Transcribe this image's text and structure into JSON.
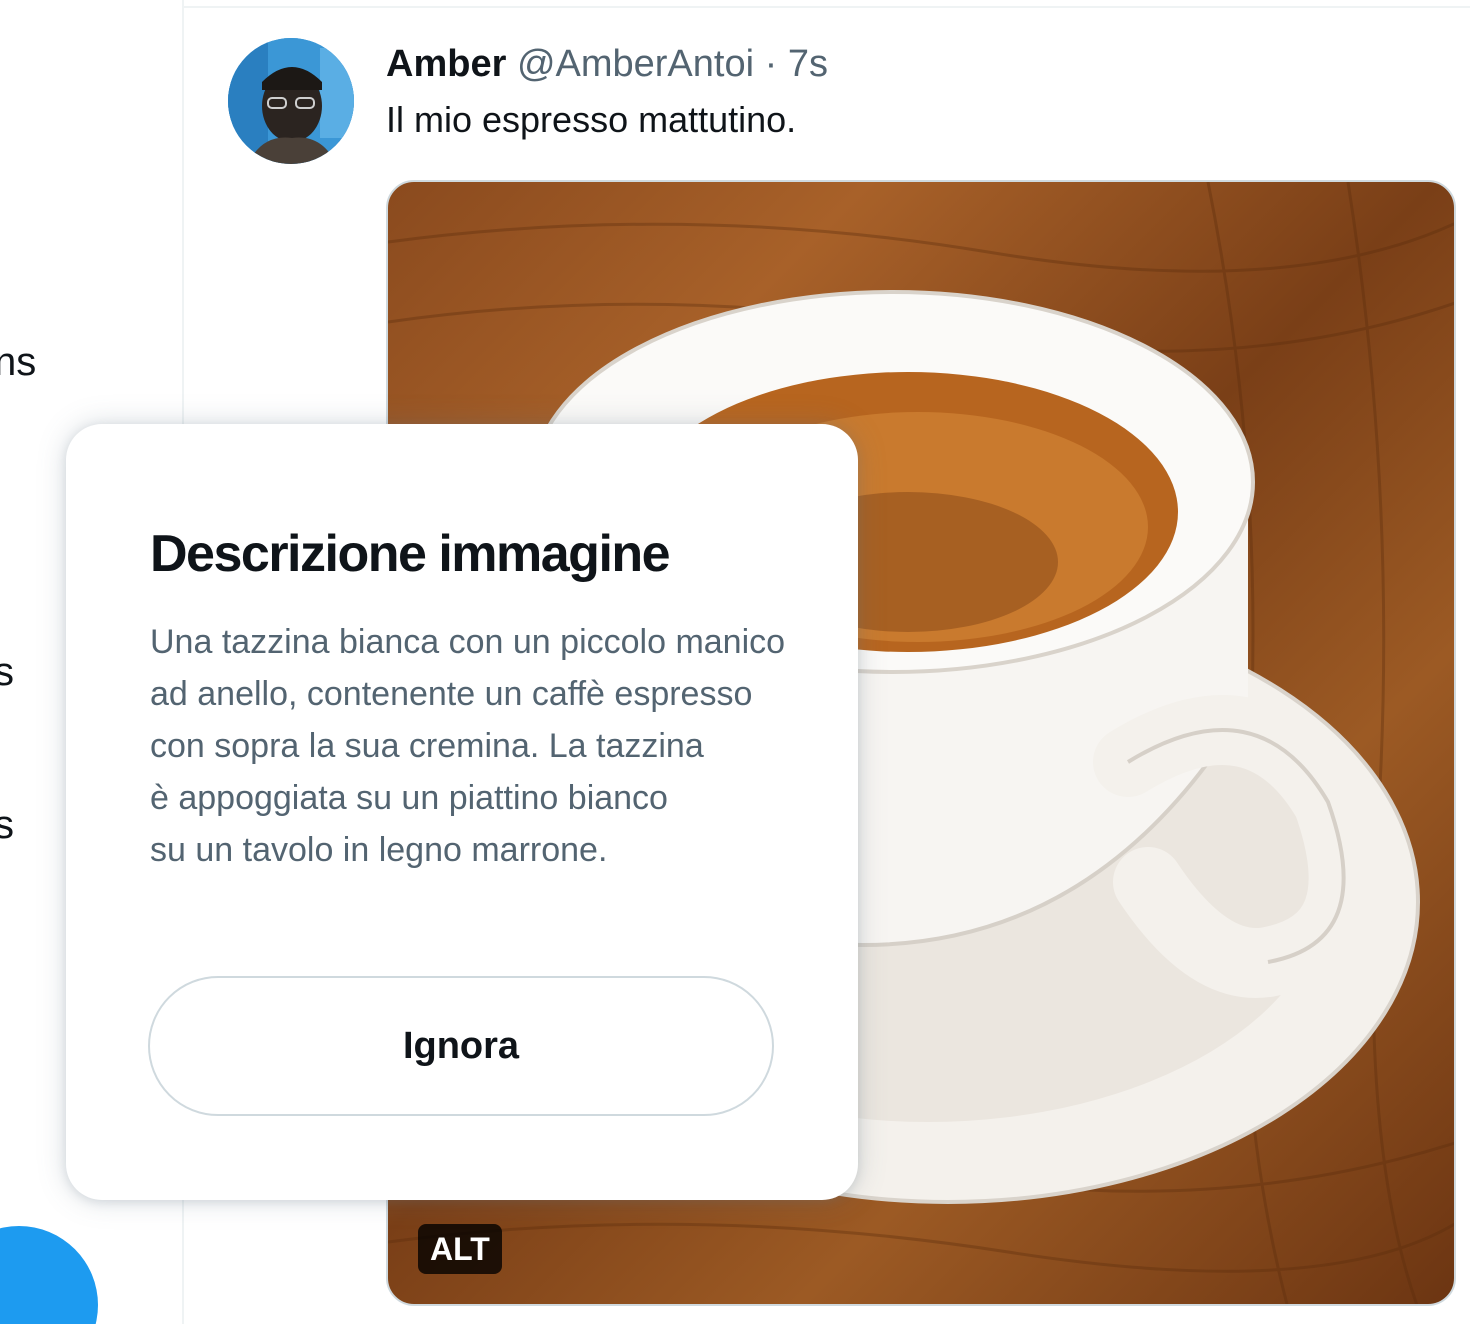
{
  "nav": {
    "items": [
      "ns",
      "s",
      "s"
    ]
  },
  "tweet": {
    "author_name": "Amber",
    "author_handle": "@AmberAntoi",
    "separator": "·",
    "timestamp": "7s",
    "text": "Il mio espresso mattutino.",
    "alt_badge": "ALT"
  },
  "popover": {
    "title": "Descrizione immagine",
    "body_lines": [
      "Una tazzina bianca con un piccolo manico",
      "ad anello, contenente un caffè espresso",
      "con sopra la sua cremina. La tazzina",
      "è appoggiata su un piattino bianco",
      "su un tavolo in legno marrone."
    ],
    "dismiss_label": "Ignora"
  },
  "colors": {
    "accent": "#1d9bf0",
    "text_primary": "#0f1419",
    "text_secondary": "#536471",
    "border": "#cfd9de"
  }
}
